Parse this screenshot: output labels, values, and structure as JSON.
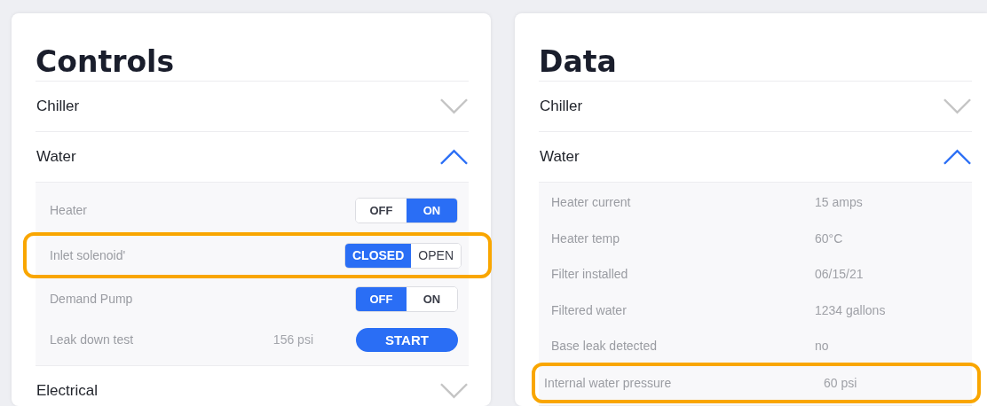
{
  "panels": [
    {
      "title": "Controls",
      "sections": [
        {
          "label": "Chiller",
          "expanded": false
        },
        {
          "label": "Water",
          "expanded": true,
          "rows": [
            {
              "kind": "toggle",
              "label": "Heater",
              "highlighted": false,
              "options": [
                {
                  "label": "OFF",
                  "selected": false
                },
                {
                  "label": "ON",
                  "selected": true
                }
              ]
            },
            {
              "kind": "toggle",
              "label": "Inlet solenoid'",
              "highlighted": true,
              "options": [
                {
                  "label": "CLOSED",
                  "selected": true
                },
                {
                  "label": "OPEN",
                  "selected": false
                }
              ]
            },
            {
              "kind": "toggle",
              "label": "Demand Pump",
              "highlighted": false,
              "options": [
                {
                  "label": "OFF",
                  "selected": true
                },
                {
                  "label": "ON",
                  "selected": false
                }
              ]
            },
            {
              "kind": "action",
              "label": "Leak down test",
              "highlighted": false,
              "reading": "156 psi",
              "button": "START"
            }
          ]
        },
        {
          "label": "Electrical",
          "expanded": false
        }
      ]
    },
    {
      "title": "Data",
      "sections": [
        {
          "label": "Chiller",
          "expanded": false
        },
        {
          "label": "Water",
          "expanded": true,
          "rows": [
            {
              "kind": "value",
              "label": "Heater current",
              "highlighted": false,
              "value": "15 amps"
            },
            {
              "kind": "value",
              "label": "Heater temp",
              "highlighted": false,
              "value": "60°C"
            },
            {
              "kind": "value",
              "label": "Filter installed",
              "highlighted": false,
              "value": "06/15/21"
            },
            {
              "kind": "value",
              "label": "Filtered water",
              "highlighted": false,
              "value": "1234 gallons"
            },
            {
              "kind": "value",
              "label": "Base leak detected",
              "highlighted": false,
              "value": "no"
            },
            {
              "kind": "value",
              "label": "Internal water pressure",
              "highlighted": true,
              "value": "60 psi"
            }
          ]
        }
      ]
    }
  ]
}
